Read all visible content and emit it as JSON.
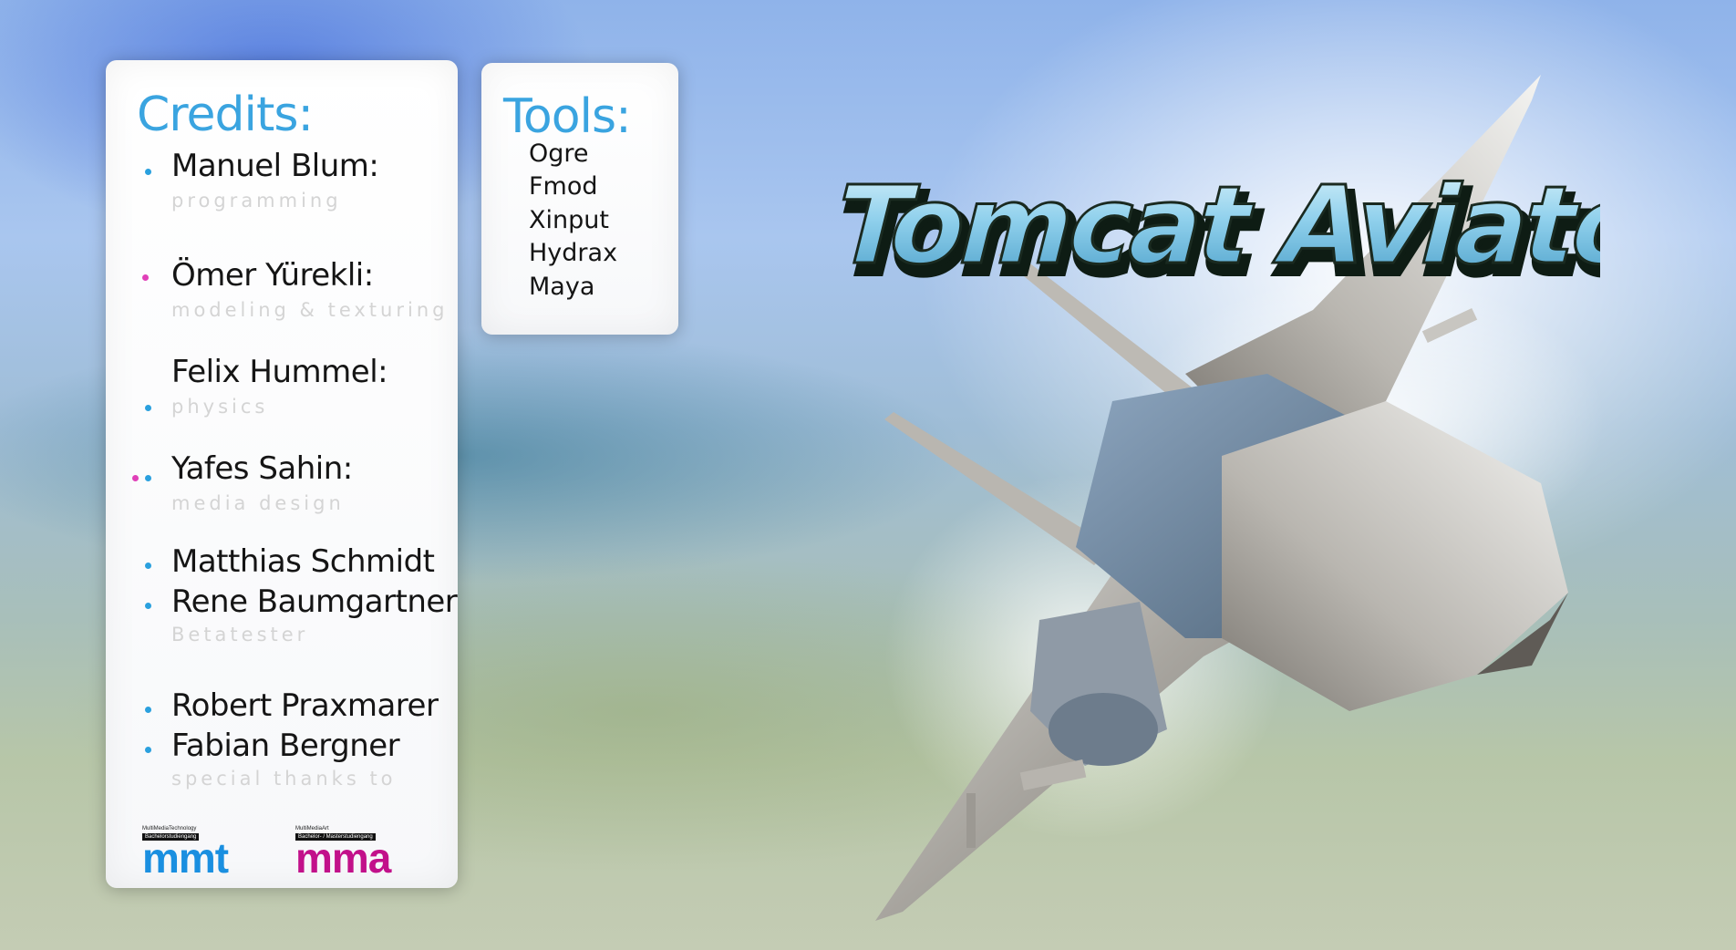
{
  "credits": {
    "heading": "Credits:",
    "entries": [
      {
        "name": "Manuel Blum:",
        "role": "programming"
      },
      {
        "name": "Ömer Yürekli:",
        "role": "modeling & texturing"
      },
      {
        "name": "Felix Hummel:",
        "role": "physics"
      },
      {
        "name": "Yafes Sahin:",
        "role": "media design"
      },
      {
        "name": "Matthias Schmidt"
      },
      {
        "name": "Rene Baumgartner",
        "role": "Betatester"
      },
      {
        "name": "Robert Praxmarer"
      },
      {
        "name": "Fabian Bergner",
        "role": "special thanks to"
      }
    ]
  },
  "tools": {
    "heading": "Tools:",
    "items": [
      "Ogre",
      "Fmod",
      "Xinput",
      "Hydrax",
      "Maya"
    ]
  },
  "logos": {
    "mmt": {
      "top": "MultiMediaTechnology",
      "band": "Bachelorstudiengang",
      "word": "mmt",
      "color": "#1a8fe0"
    },
    "mma": {
      "top": "MultiMediaArt",
      "band": "Bachelor- / Masterstudiengang",
      "word": "mma",
      "color": "#c2118a"
    }
  },
  "game": {
    "title": "Tomcat Aviator"
  },
  "colors": {
    "accent": "#3aa4e0",
    "pink": "#e040b8"
  }
}
